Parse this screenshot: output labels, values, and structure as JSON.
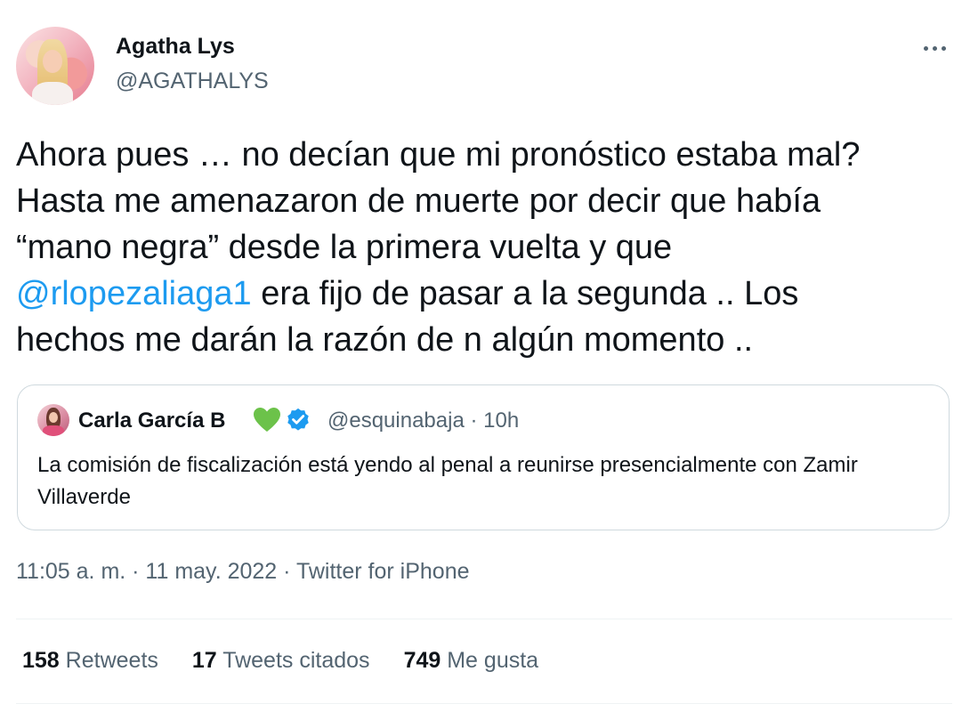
{
  "author": {
    "name": "Agatha Lys",
    "handle": "@AGATHALYS"
  },
  "tweet": {
    "line1": "Ahora pues … no decían que mi pronóstico estaba mal?",
    "line2": "Hasta me amenazaron de muerte por decir que había",
    "line3": "“mano negra” desde la primera vuelta y que",
    "mention": "@rlopezaliaga1",
    "line4_rest": " era fijo de pasar a la segunda .. Los",
    "line5": "hechos me darán la razón de n algún momento .."
  },
  "quoted": {
    "name": "Carla García B",
    "handle_time": "@esquinabaja · 10h",
    "text": "La comisión de fiscalización está yendo al penal a reunirse presencialmente con Zamir Villaverde",
    "name_emoji_icon": "green-heart-icon",
    "badge_icon": "verified-badge-icon"
  },
  "meta": {
    "timestamp": "11:05 a. m. · 11 may. 2022 · ",
    "source": "Twitter for iPhone"
  },
  "stats": {
    "retweets_count": "158",
    "retweets_label": "Retweets",
    "quotes_count": "17",
    "quotes_label": "Tweets citados",
    "likes_count": "749",
    "likes_label": "Me gusta"
  },
  "colors": {
    "link": "#1d9bf0",
    "secondary_text": "#536471",
    "primary_text": "#0f1419",
    "border": "#cfd9de",
    "heart": "#6cc24a"
  }
}
